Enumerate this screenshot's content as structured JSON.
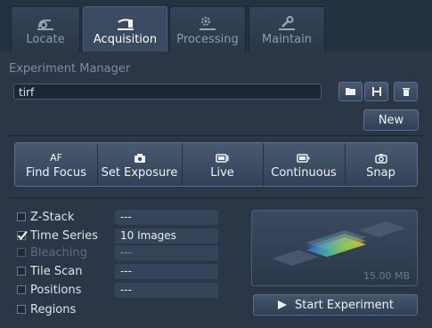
{
  "tabs": [
    {
      "label": "Locate",
      "icon": "microscope-icon",
      "active": false
    },
    {
      "label": "Acquisition",
      "icon": "camera-arm-icon",
      "active": true
    },
    {
      "label": "Processing",
      "icon": "gear-processing-icon",
      "active": false
    },
    {
      "label": "Maintain",
      "icon": "wrench-icon",
      "active": false
    }
  ],
  "experiment_manager": {
    "title": "Experiment Manager",
    "experiment_name": "tirf",
    "new_label": "New",
    "icons": [
      "folder-open-icon",
      "save-icon",
      "delete-icon"
    ]
  },
  "actions": [
    {
      "top": "AF",
      "label": "Find Focus",
      "icon": ""
    },
    {
      "top": "",
      "label": "Set Exposure",
      "icon": "camera-icon"
    },
    {
      "top": "",
      "label": "Live",
      "icon": "live-icon"
    },
    {
      "top": "",
      "label": "Continuous",
      "icon": "continuous-icon"
    },
    {
      "top": "",
      "label": "Snap",
      "icon": "snap-camera-icon"
    }
  ],
  "options": [
    {
      "label": "Z-Stack",
      "checked": false,
      "enabled": true,
      "value": "---"
    },
    {
      "label": "Time Series",
      "checked": true,
      "enabled": true,
      "value": "10 Images"
    },
    {
      "label": "Bleaching",
      "checked": false,
      "enabled": false,
      "value": "---"
    },
    {
      "label": "Tile Scan",
      "checked": false,
      "enabled": true,
      "value": "---"
    },
    {
      "label": "Positions",
      "checked": false,
      "enabled": true,
      "value": "---"
    },
    {
      "label": "Regions",
      "checked": false,
      "enabled": true,
      "value": ""
    }
  ],
  "preview": {
    "size": "15.00 MB"
  },
  "start_label": "Start Experiment",
  "colors": {
    "accent": "#3a4a60",
    "background": "#2b3747",
    "text": "#dfe5ee"
  }
}
